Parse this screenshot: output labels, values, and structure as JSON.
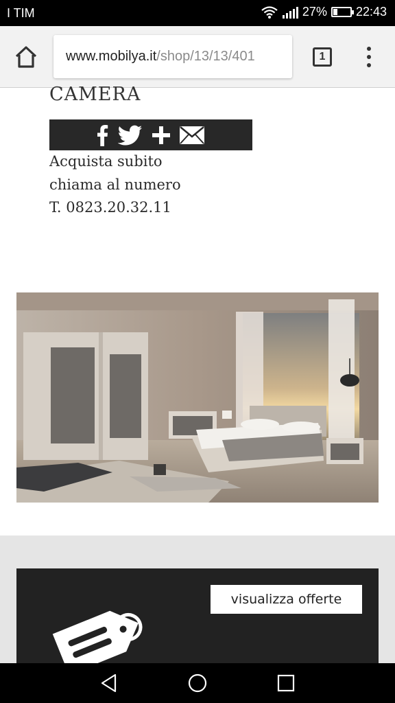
{
  "status_bar": {
    "carrier": "I TIM",
    "battery_percent": "27%",
    "battery_level": 0.27,
    "time": "22:43",
    "icons": [
      "wifi-icon",
      "signal-icon",
      "battery-icon"
    ]
  },
  "browser": {
    "url_domain": "www.mobilya.it",
    "url_path": "/shop/13/13/401",
    "tab_count": "1",
    "icons": [
      "home-icon",
      "tabs-icon",
      "overflow-menu-icon"
    ]
  },
  "page": {
    "title": "CAMERA",
    "share_icons": [
      "facebook-icon",
      "twitter-icon",
      "plus-icon",
      "mail-icon"
    ],
    "contact_lines": [
      "Acquista subito",
      "chiama al numero",
      "T. 0823.20.32.11"
    ],
    "product_image": "bedroom-product-photo",
    "offers_button": "visualizza offerte",
    "offers_icon": "price-tag-icon"
  },
  "nav_bar": {
    "icons": [
      "back-icon",
      "home-circle-icon",
      "recents-icon"
    ]
  },
  "colors": {
    "share_bar_bg": "#282828",
    "offers_card_bg": "#222222",
    "offers_section_bg": "#e5e5e5",
    "toolbar_bg": "#f2f2f2"
  }
}
